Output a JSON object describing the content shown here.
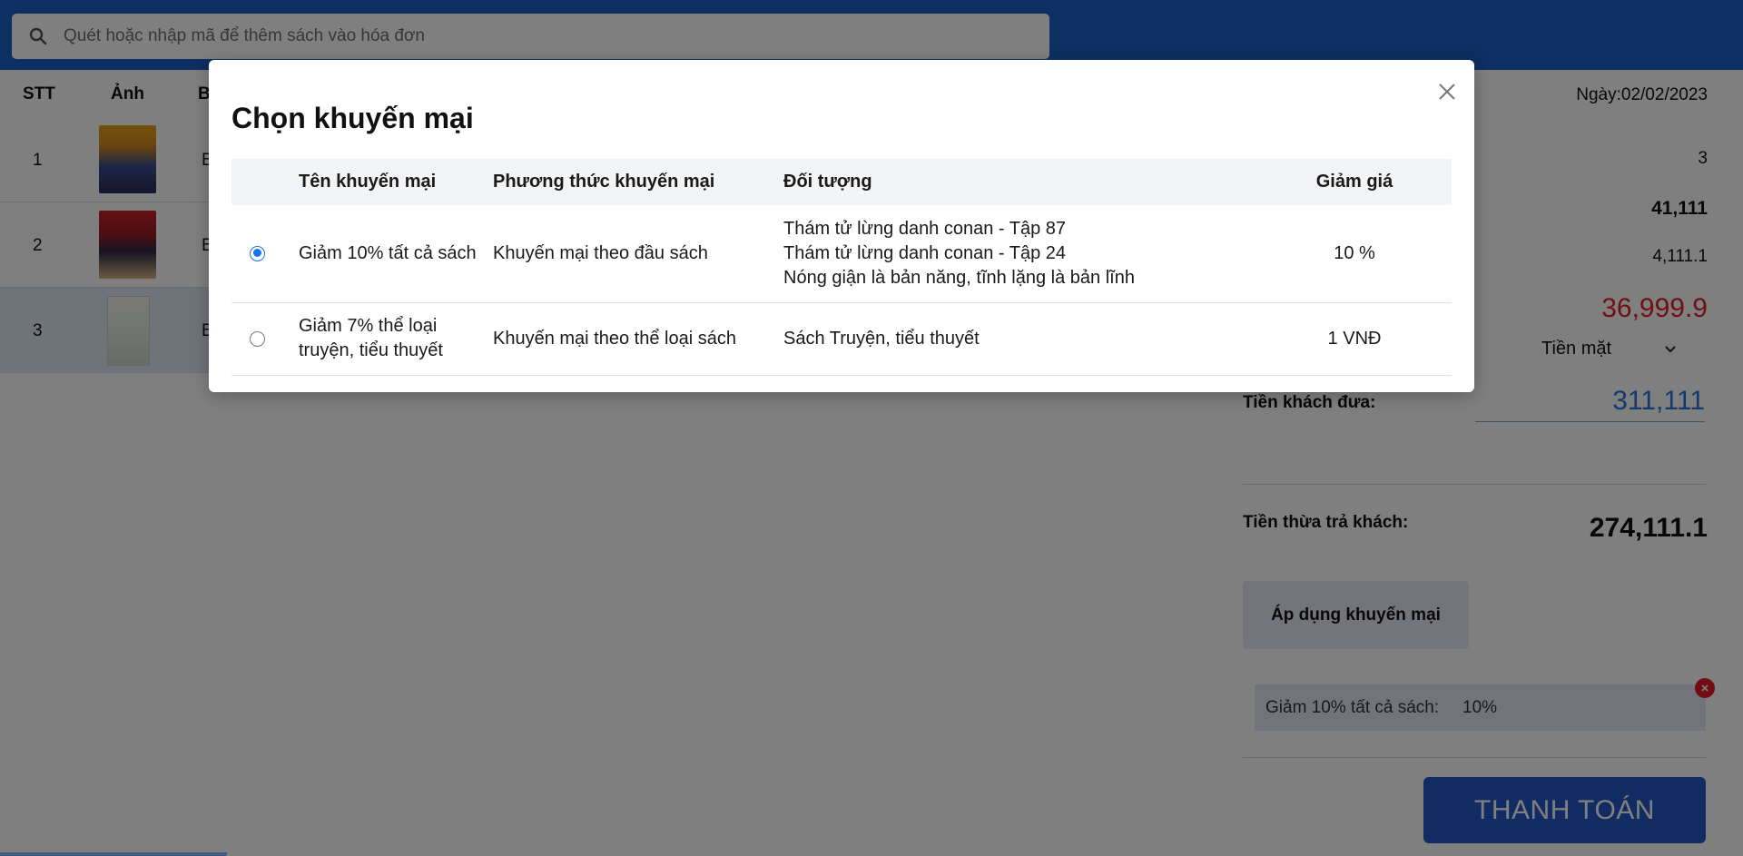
{
  "search": {
    "placeholder": "Quét hoặc nhập mã để thêm sách vào hóa đơn",
    "icon": "search-icon"
  },
  "table": {
    "headers": {
      "index": "STT",
      "image": "Ảnh",
      "code": "B"
    },
    "rows": [
      {
        "index": "1",
        "code": "B",
        "thumb_color": "#b8863a"
      },
      {
        "index": "2",
        "code": "B",
        "thumb_color": "#8b2f2f"
      },
      {
        "index": "3",
        "code": "B",
        "thumb_color": "#e6ebe0"
      }
    ]
  },
  "invoice": {
    "date": "Ngày:02/02/2023",
    "quantity": "3",
    "subtotal": "41,111",
    "discount": "4,111.1",
    "total": "36,999.9",
    "payment_method": "Tiền mặt",
    "given_label": "Tiền khách đưa:",
    "given_value": "311,111",
    "change_label": "Tiền thừa trả khách:",
    "change_value": "274,111.1",
    "apply_button": "Áp dụng khuyến mại",
    "applied_promo": {
      "name": "Giảm 10% tất cả sách:",
      "percent": "10%"
    },
    "pay_button": "THANH TOÁN"
  },
  "modal": {
    "title": "Chọn khuyến mại",
    "columns": {
      "name": "Tên khuyến mại",
      "method": "Phương thức khuyến mại",
      "target": "Đối tượng",
      "discount": "Giảm giá"
    },
    "promotions": [
      {
        "selected": true,
        "name": "Giảm 10% tất cả sách",
        "method": "Khuyến mại theo đầu sách",
        "targets": [
          "Thám tử lừng danh conan - Tập 87",
          "Thám tử lừng danh conan - Tập 24",
          "Nóng giận là bản năng, tĩnh lặng là bản lĩnh"
        ],
        "discount": "10 %"
      },
      {
        "selected": false,
        "name": "Giảm 7% thể loại truyện, tiểu thuyết",
        "method": "Khuyến mại theo thể loại sách",
        "targets": [
          "Sách Truyện, tiểu thuyết"
        ],
        "discount": "1 VNĐ"
      }
    ]
  },
  "colors": {
    "topbar": "#1b5fc2",
    "total": "#e0202a",
    "given": "#2d72d9",
    "pay_button": "#2356c6",
    "radio_selected": "#1a73e8"
  }
}
